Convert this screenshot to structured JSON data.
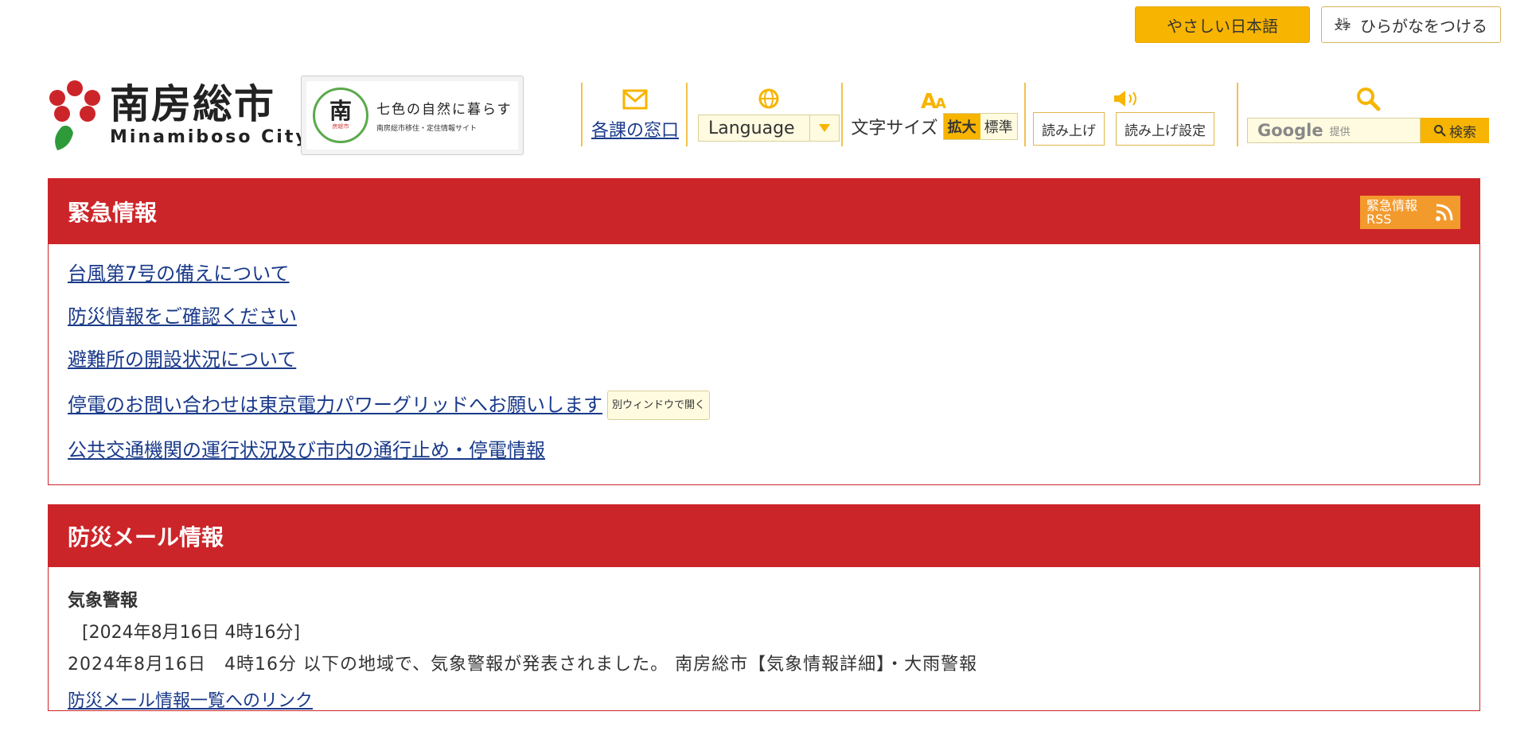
{
  "topbar": {
    "easy_japanese": "やさしい日本語",
    "ruby_icon_top": "もじ",
    "ruby_icon_main": "文字",
    "ruby_label": "ひらがなをつける"
  },
  "header": {
    "logo_jp": "南房総市",
    "logo_en": "Minamiboso City",
    "banner": {
      "seal_char": "南",
      "seal_small": "房総市",
      "title": "七色の自然に暮らす",
      "subtitle": "南房総市移住・定住情報サイト"
    },
    "tools": {
      "contact_label": "各課の窓口",
      "language_label": "Language",
      "font_size_label": "文字サイズ",
      "font_big": "拡大",
      "font_std": "標準",
      "read_aloud": "読み上げ",
      "read_settings": "読み上げ設定",
      "search_brand": "Google",
      "search_provided": "提供",
      "search_button": "検索"
    }
  },
  "emergency": {
    "title": "緊急情報",
    "rss_line1": "緊急情報",
    "rss_line2": "RSS",
    "links": [
      "台風第7号の備えについて",
      "防災情報をご確認ください",
      "避難所の開設状況について",
      "停電のお問い合わせは東京電力パワーグリッドへお願いします",
      "公共交通機関の運行状況及び市内の通行止め・停電情報"
    ],
    "external_tag": "別ウィンドウで開く"
  },
  "disaster_mail": {
    "title": "防災メール情報",
    "item_title": "気象警報",
    "item_date": "[2024年8月16日 4時16分]",
    "item_text": "2024年8月16日　4時16分 以下の地域で、気象警報が発表されました。 南房総市【気象情報詳細】・大雨警報",
    "list_link": "防災メール情報一覧へのリンク"
  },
  "colors": {
    "accent": "#f7b400",
    "emergency_red": "#cc2529",
    "rss_orange": "#f39a2d"
  }
}
